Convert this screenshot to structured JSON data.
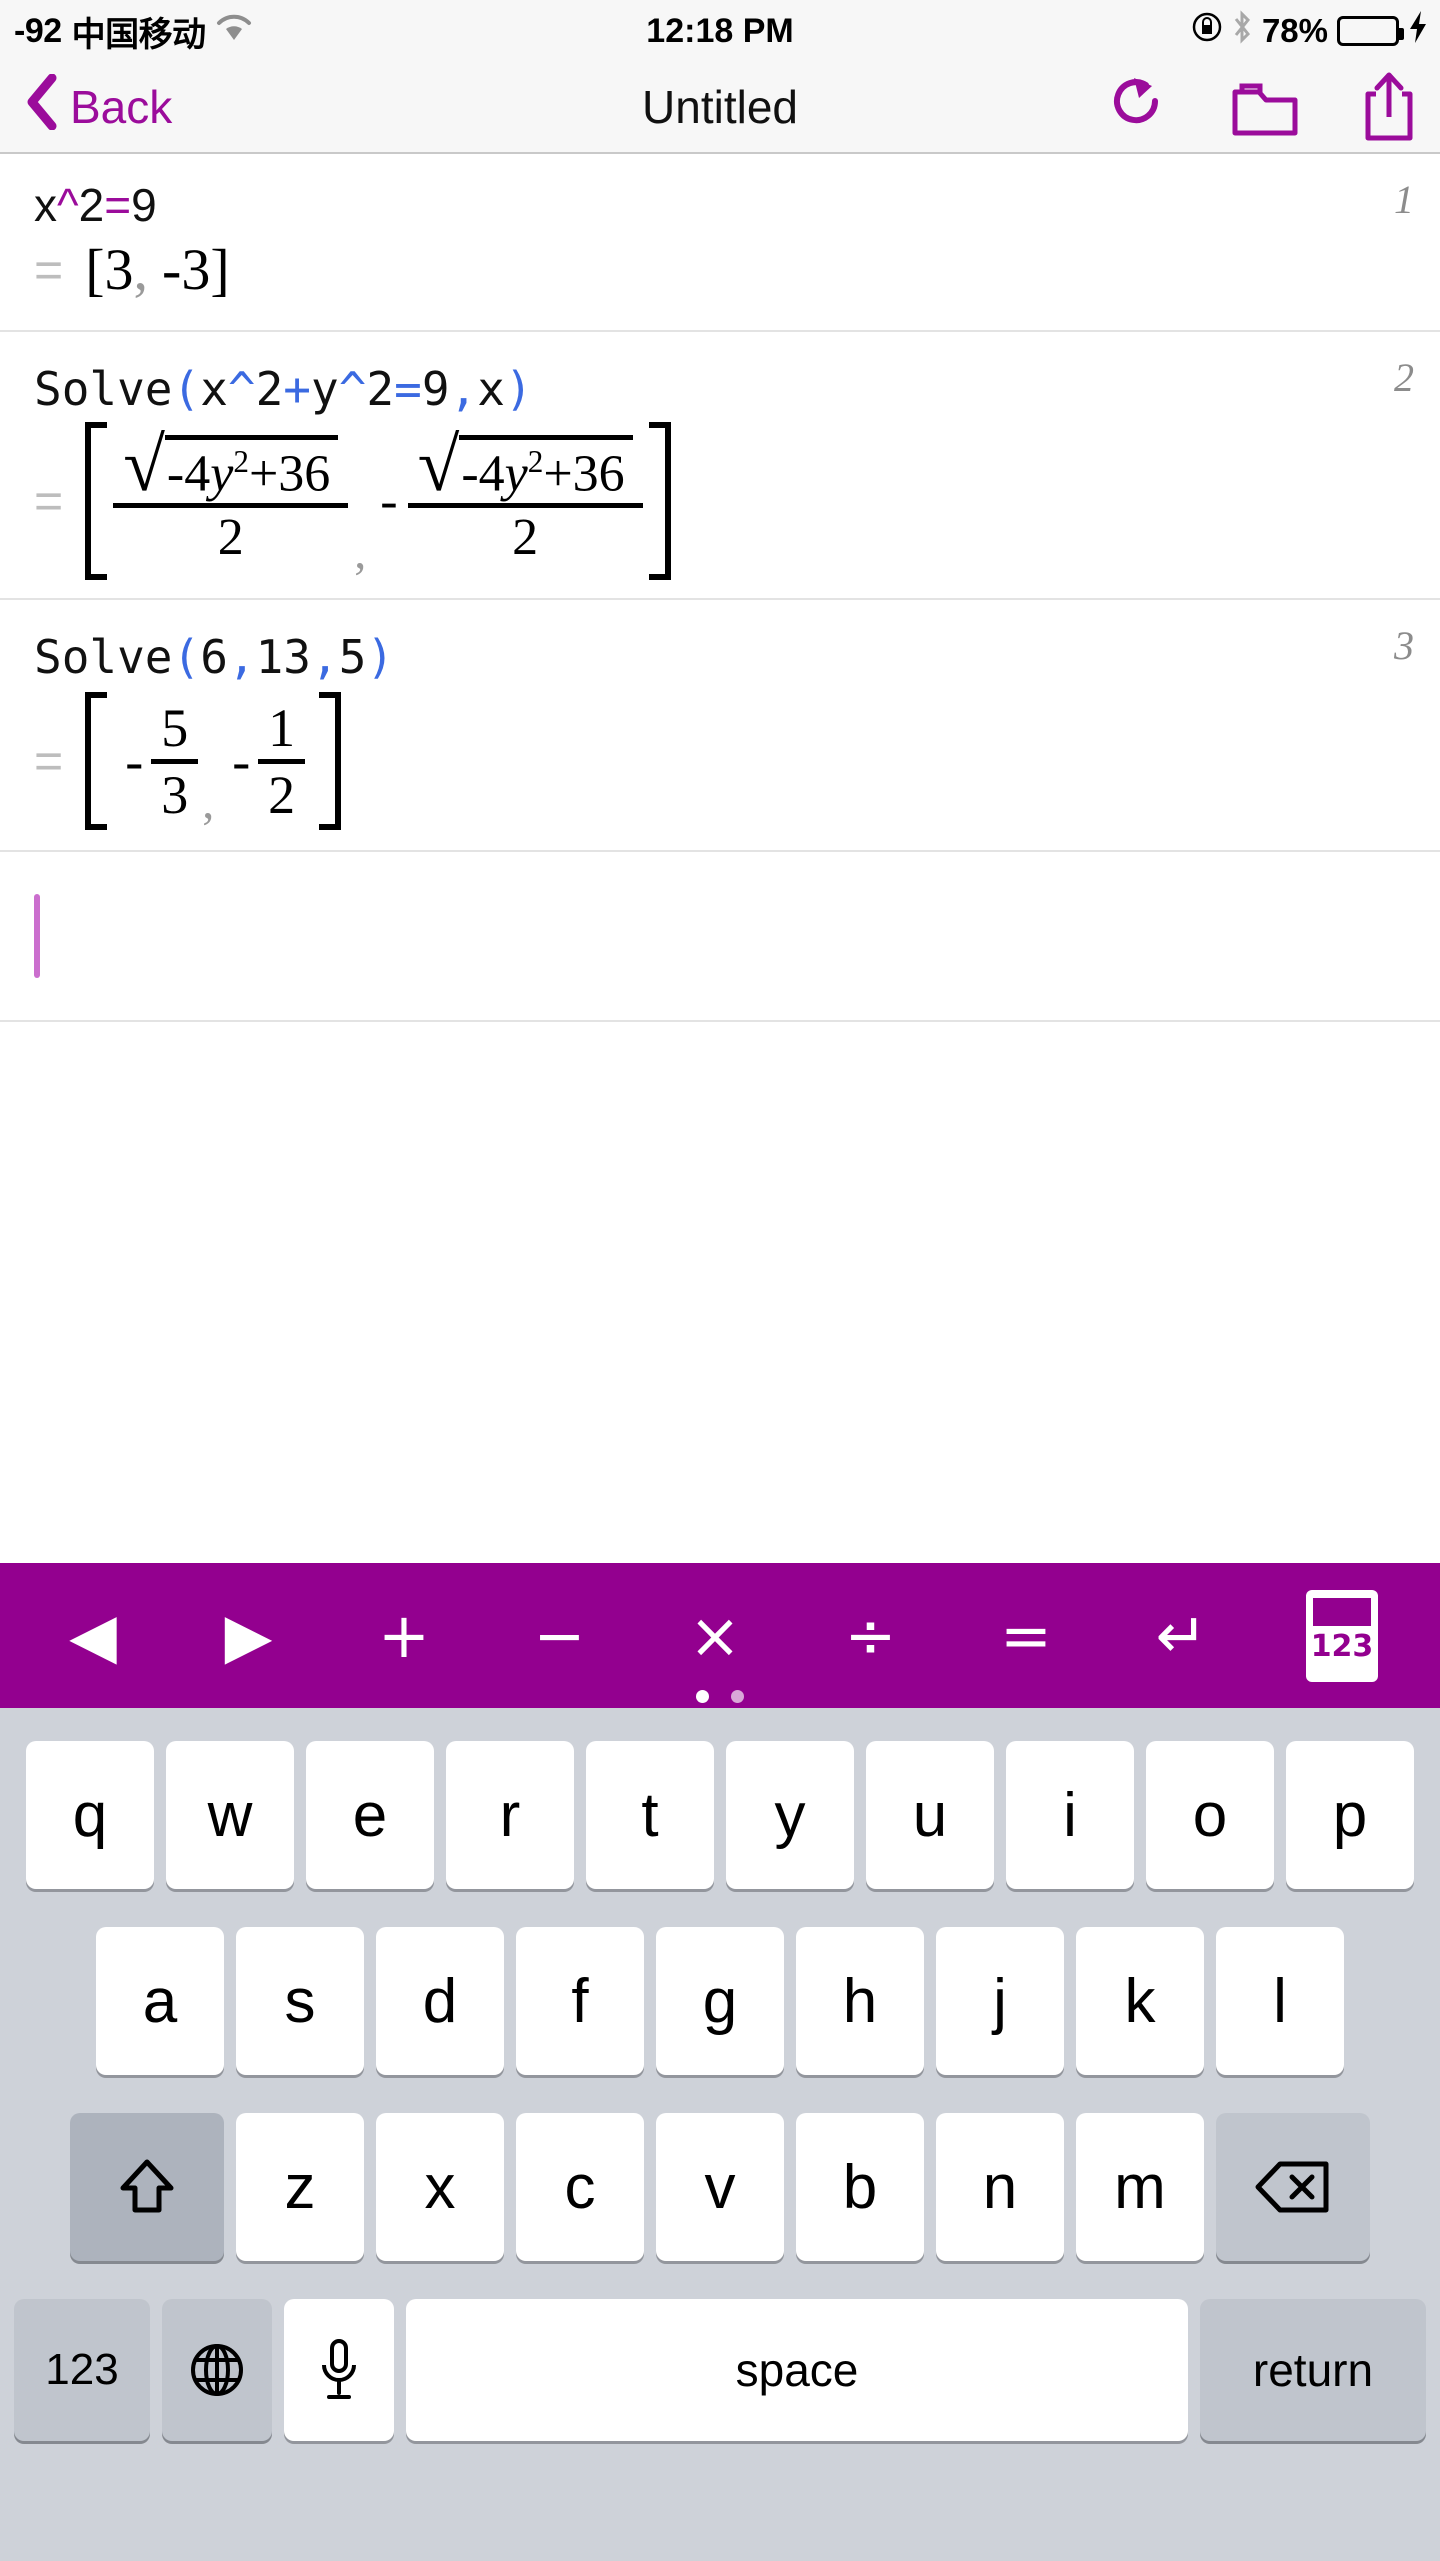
{
  "status_bar": {
    "signal_text": "-92",
    "carrier": "中国移动",
    "wifi_icon": "wifi-icon",
    "time": "12:18 PM",
    "rotation_lock_icon": "rotation-lock-icon",
    "bluetooth_icon": "bluetooth-icon",
    "battery_percent": "78%",
    "battery_level": 78,
    "charging_icon": "lightning-bolt-icon"
  },
  "nav_bar": {
    "back_label": "Back",
    "back_icon": "chevron-left-icon",
    "title": "Untitled",
    "redo_icon": "redo-icon",
    "folder_icon": "folder-icon",
    "share_icon": "share-icon",
    "accent_color": "#9b0c9b"
  },
  "worksheet": {
    "rows": [
      {
        "line_number": "1",
        "input_parts": [
          {
            "t": "x",
            "c": "plain"
          },
          {
            "t": "^",
            "c": "op"
          },
          {
            "t": "2",
            "c": "plain"
          },
          {
            "t": "=",
            "c": "op"
          },
          {
            "t": "9",
            "c": "plain"
          }
        ],
        "input_plain": "x^2=9",
        "result_plain": "= [3, -3]",
        "result_values": [
          "3",
          "-3"
        ]
      },
      {
        "line_number": "2",
        "input_parts": [
          {
            "t": "Solve",
            "c": "plain"
          },
          {
            "t": "(",
            "c": "paren"
          },
          {
            "t": "x",
            "c": "plain"
          },
          {
            "t": "^",
            "c": "paren"
          },
          {
            "t": "2",
            "c": "plain"
          },
          {
            "t": "+",
            "c": "paren"
          },
          {
            "t": "y",
            "c": "plain"
          },
          {
            "t": "^",
            "c": "paren"
          },
          {
            "t": "2",
            "c": "plain"
          },
          {
            "t": "=",
            "c": "paren"
          },
          {
            "t": "9",
            "c": "plain"
          },
          {
            "t": ",",
            "c": "paren"
          },
          {
            "t": "x",
            "c": "plain"
          },
          {
            "t": ")",
            "c": "paren"
          }
        ],
        "input_plain": "Solve(x^2+y^2=9,x)",
        "result_plain": "= [ sqrt(-4y^2+36)/2 , -sqrt(-4y^2+36)/2 ]",
        "result_terms": [
          {
            "sign": "",
            "radicand_lead": "-4",
            "radicand_var": "y",
            "radicand_pow": "2",
            "radicand_plus": "+",
            "radicand_const": "36",
            "denominator": "2"
          },
          {
            "sign": "-",
            "radicand_lead": "-4",
            "radicand_var": "y",
            "radicand_pow": "2",
            "radicand_plus": "+",
            "radicand_const": "36",
            "denominator": "2"
          }
        ]
      },
      {
        "line_number": "3",
        "input_parts": [
          {
            "t": "Solve",
            "c": "plain"
          },
          {
            "t": "(",
            "c": "paren"
          },
          {
            "t": "6",
            "c": "plain"
          },
          {
            "t": ",",
            "c": "paren"
          },
          {
            "t": "13",
            "c": "plain"
          },
          {
            "t": ",",
            "c": "paren"
          },
          {
            "t": "5",
            "c": "plain"
          },
          {
            "t": ")",
            "c": "paren"
          }
        ],
        "input_plain": "Solve(6,13,5)",
        "result_plain": "= [ -5/3 , -1/2 ]",
        "result_fractions": [
          {
            "sign": "-",
            "numerator": "5",
            "denominator": "3"
          },
          {
            "sign": "-",
            "numerator": "1",
            "denominator": "2"
          }
        ]
      }
    ],
    "equals_symbol": "=",
    "comma_symbol": ",",
    "bracket_open": "[",
    "bracket_close": "]",
    "cursor_row_value": ""
  },
  "accessory_toolbar": {
    "background_color": "#93008f",
    "buttons": [
      {
        "name": "cursor-left",
        "label": "◀"
      },
      {
        "name": "cursor-right",
        "label": "▶"
      },
      {
        "name": "plus",
        "label": "+"
      },
      {
        "name": "minus",
        "label": "−"
      },
      {
        "name": "multiply",
        "label": "×"
      },
      {
        "name": "divide",
        "label": "÷"
      },
      {
        "name": "equals",
        "label": "="
      },
      {
        "name": "return",
        "label": "↵"
      },
      {
        "name": "numeric-keypad",
        "label": "123"
      }
    ],
    "page_dots": {
      "count": 2,
      "active_index": 0
    }
  },
  "keyboard": {
    "row1": [
      "q",
      "w",
      "e",
      "r",
      "t",
      "y",
      "u",
      "i",
      "o",
      "p"
    ],
    "row2": [
      "a",
      "s",
      "d",
      "f",
      "g",
      "h",
      "j",
      "k",
      "l"
    ],
    "row3": [
      "z",
      "x",
      "c",
      "v",
      "b",
      "n",
      "m"
    ],
    "shift_icon": "shift-arrow-icon",
    "delete_icon": "backspace-icon",
    "numeric_label": "123",
    "globe_icon": "globe-icon",
    "mic_icon": "microphone-icon",
    "space_label": "space",
    "return_label": "return",
    "background_color": "#ced2d9"
  }
}
